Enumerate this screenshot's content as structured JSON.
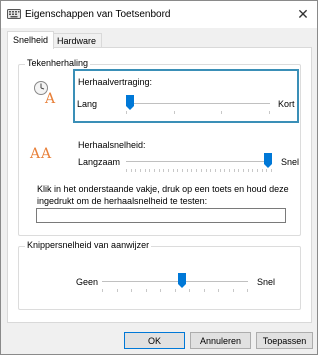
{
  "window": {
    "title": "Eigenschappen van Toetsenbord",
    "close_glyph": "✕"
  },
  "tabs": [
    {
      "label": "Snelheid",
      "active": true
    },
    {
      "label": "Hardware",
      "active": false
    }
  ],
  "char_repeat": {
    "group_label": "Tekenherhaling",
    "delay": {
      "label": "Herhaalvertraging:",
      "min_label": "Lang",
      "max_label": "Kort",
      "value_fraction": 0.0,
      "ticks": 4
    },
    "rate": {
      "label": "Herhaalsnelheid:",
      "min_label": "Langzaam",
      "max_label": "Snel",
      "value_fraction": 1.0,
      "ticks": 32
    },
    "test_instructions": "Klik in het onderstaande vakje, druk op een toets en houd deze ingedrukt om de herhaalsnelheid te testen:",
    "test_value": ""
  },
  "cursor_blink": {
    "group_label": "Knippersnelheid van aanwijzer",
    "min_label": "Geen",
    "max_label": "Snel",
    "value_fraction": 0.55,
    "ticks": 11
  },
  "buttons": {
    "ok": "OK",
    "cancel": "Annuleren",
    "apply": "Toepassen"
  },
  "colors": {
    "accent": "#0078d7",
    "focus": "#3a8fb7",
    "icon_orange": "#e8803a"
  },
  "icons": {
    "title": "keyboard-icon",
    "delay": "repeat-delay-icon",
    "rate": "repeat-rate-icon",
    "blink": "cursor-blink-icon"
  }
}
